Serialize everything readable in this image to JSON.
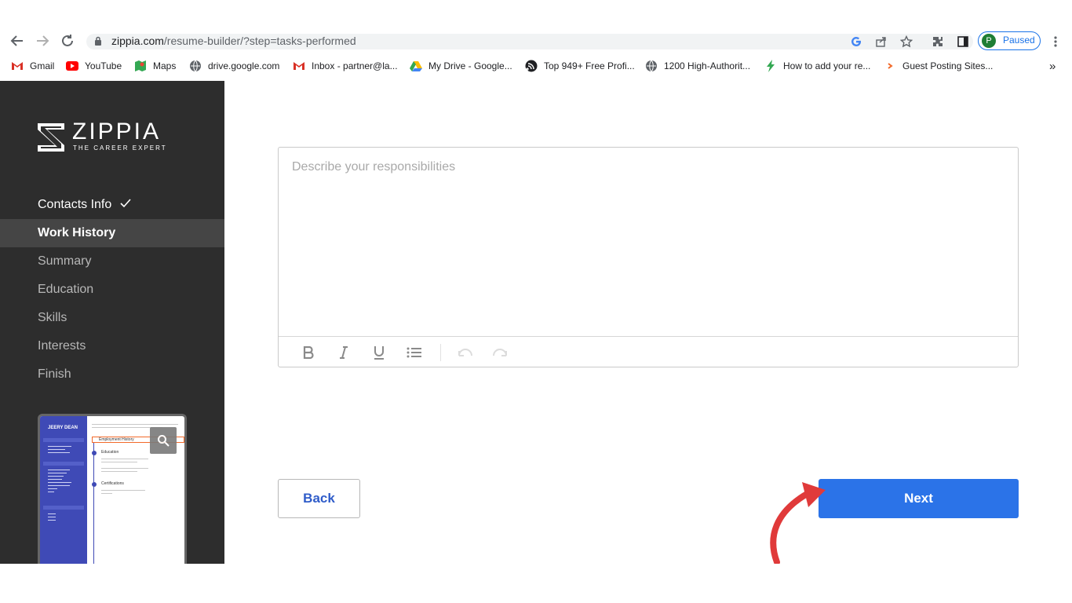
{
  "browser": {
    "url_host": "zippia.com",
    "url_path": "/resume-builder/?step=tasks-performed",
    "profile_initial": "P",
    "profile_status": "Paused",
    "bookmarks": [
      {
        "label": "Gmail",
        "icon": "gmail-icon"
      },
      {
        "label": "YouTube",
        "icon": "youtube-icon"
      },
      {
        "label": "Maps",
        "icon": "maps-icon"
      },
      {
        "label": "drive.google.com",
        "icon": "globe-icon"
      },
      {
        "label": "Inbox - partner@la...",
        "icon": "gmail-icon"
      },
      {
        "label": "My Drive - Google...",
        "icon": "drive-icon"
      },
      {
        "label": "Top 949+ Free Profi...",
        "icon": "feed-icon"
      },
      {
        "label": "1200 High-Authorit...",
        "icon": "globe-icon"
      },
      {
        "label": "How to add your re...",
        "icon": "bolt-icon"
      },
      {
        "label": "Guest Posting Sites...",
        "icon": "chevron-icon"
      }
    ],
    "bookmarks_overflow": "»"
  },
  "sidebar": {
    "logo_word": "ZIPPIA",
    "logo_tagline": "THE CAREER EXPERT",
    "items": [
      {
        "label": "Contacts Info",
        "state": "done"
      },
      {
        "label": "Work History",
        "state": "active"
      },
      {
        "label": "Summary",
        "state": "pending"
      },
      {
        "label": "Education",
        "state": "pending"
      },
      {
        "label": "Skills",
        "state": "pending"
      },
      {
        "label": "Interests",
        "state": "pending"
      },
      {
        "label": "Finish",
        "state": "pending"
      }
    ],
    "preview": {
      "name": "JEERY DEAN",
      "highlight": "Employment History",
      "sections": [
        "Education",
        "Certifications"
      ]
    }
  },
  "editor": {
    "placeholder": "Describe your responsibilities"
  },
  "actions": {
    "back_label": "Back",
    "next_label": "Next"
  },
  "colors": {
    "sidebar_bg": "#2d2d2d",
    "accent": "#2b73e8",
    "arrow": "#e03a3a"
  }
}
